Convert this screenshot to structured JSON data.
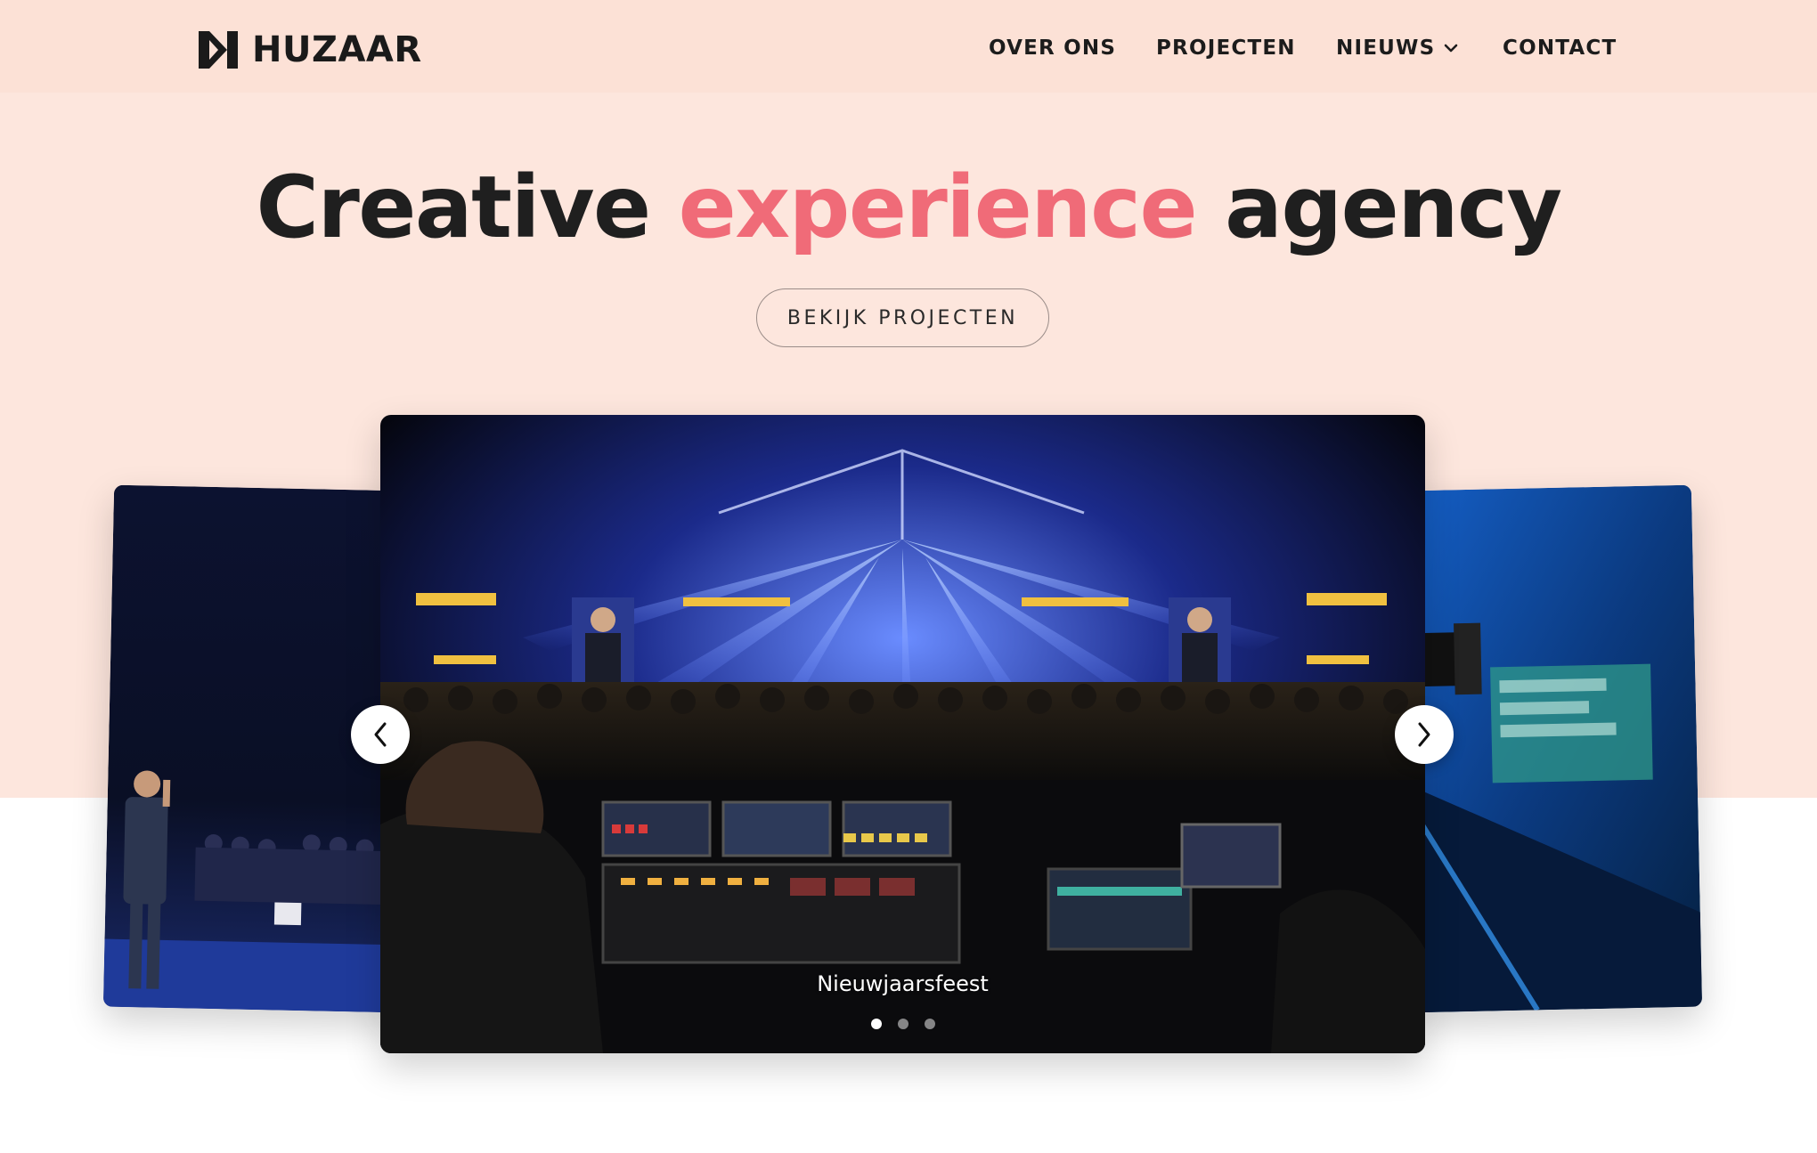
{
  "brand": {
    "name": "HUZAAR"
  },
  "nav": {
    "items": [
      {
        "label": "OVER ONS"
      },
      {
        "label": "PROJECTEN"
      },
      {
        "label": "NIEUWS",
        "has_dropdown": true
      },
      {
        "label": "CONTACT"
      }
    ]
  },
  "hero": {
    "headline_before": "Creative",
    "headline_accent": "experience",
    "headline_after": "agency",
    "cta_label": "BEKIJK PROJECTEN"
  },
  "carousel": {
    "caption": "Nieuwjaarsfeest",
    "slide_count": 3,
    "active_index": 0
  },
  "colors": {
    "hero_background": "#fde6dd",
    "header_background": "#fce1d6",
    "accent": "#f06b78",
    "text": "#1f1f1f"
  },
  "icons": {
    "logo": "huzaar-logo-mark",
    "nav_dropdown": "chevron-down-icon",
    "prev": "chevron-left-icon",
    "next": "chevron-right-icon"
  }
}
